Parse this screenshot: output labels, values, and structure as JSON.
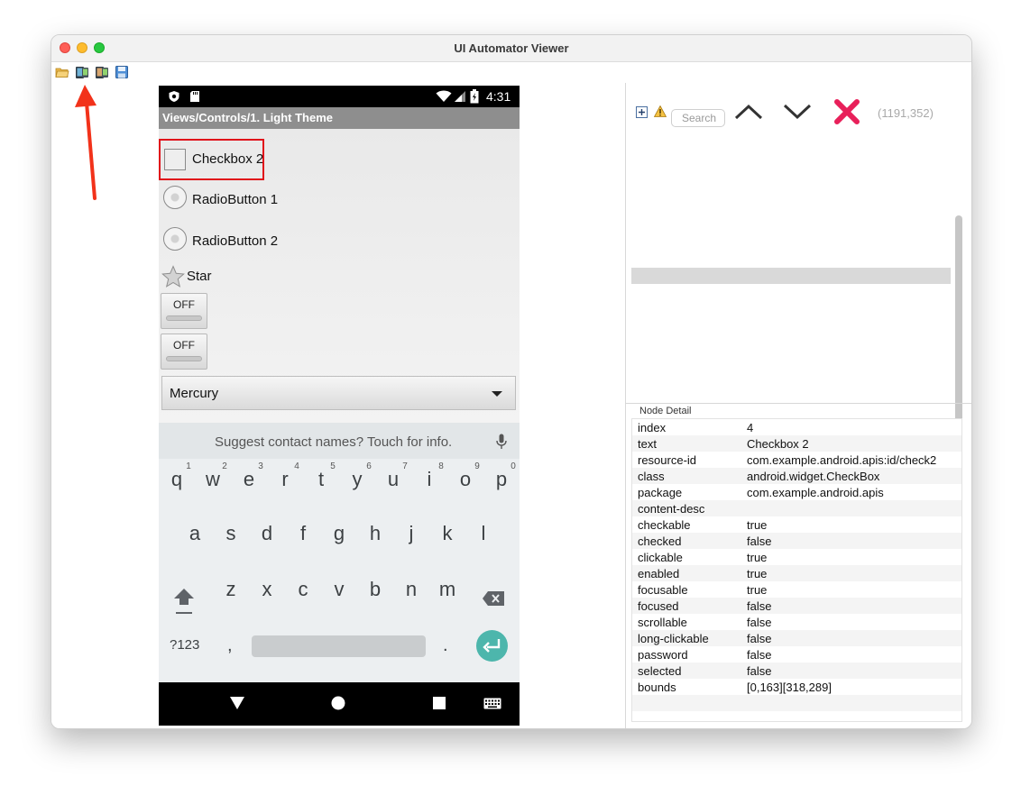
{
  "window": {
    "title": "UI Automator Viewer"
  },
  "phone": {
    "status_time": "4:31",
    "action_bar_title": "Views/Controls/1. Light Theme",
    "controls": {
      "checkbox_label": "Checkbox 2",
      "radio1_label": "RadioButton 1",
      "radio2_label": "RadioButton 2",
      "star_label": "Star",
      "toggle1_label": "OFF",
      "toggle2_label": "OFF",
      "spinner_value": "Mercury"
    },
    "keyboard": {
      "suggestion": "Suggest contact names? Touch for info.",
      "row1": [
        "q",
        "w",
        "e",
        "r",
        "t",
        "y",
        "u",
        "i",
        "o",
        "p"
      ],
      "row1_numbers": [
        "1",
        "2",
        "3",
        "4",
        "5",
        "6",
        "7",
        "8",
        "9",
        "0"
      ],
      "row2": [
        "a",
        "s",
        "d",
        "f",
        "g",
        "h",
        "j",
        "k",
        "l"
      ],
      "row3": [
        "z",
        "x",
        "c",
        "v",
        "b",
        "n",
        "m"
      ],
      "symbols_key": "?123",
      "comma_key": ",",
      "period_key": "."
    }
  },
  "right_panel": {
    "search_placeholder": "Search",
    "coordinates": "(1191,352)",
    "node_detail_title": "Node Detail",
    "node_detail": [
      {
        "key": "index",
        "value": "4"
      },
      {
        "key": "text",
        "value": "Checkbox 2"
      },
      {
        "key": "resource-id",
        "value": "com.example.android.apis:id/check2"
      },
      {
        "key": "class",
        "value": "android.widget.CheckBox"
      },
      {
        "key": "package",
        "value": "com.example.android.apis"
      },
      {
        "key": "content-desc",
        "value": ""
      },
      {
        "key": "checkable",
        "value": "true"
      },
      {
        "key": "checked",
        "value": "false"
      },
      {
        "key": "clickable",
        "value": "true"
      },
      {
        "key": "enabled",
        "value": "true"
      },
      {
        "key": "focusable",
        "value": "true"
      },
      {
        "key": "focused",
        "value": "false"
      },
      {
        "key": "scrollable",
        "value": "false"
      },
      {
        "key": "long-clickable",
        "value": "false"
      },
      {
        "key": "password",
        "value": "false"
      },
      {
        "key": "selected",
        "value": "false"
      },
      {
        "key": "bounds",
        "value": "[0,163][318,289]"
      }
    ]
  },
  "colors": {
    "highlight": "#e0101a",
    "arrow": "#f2321a",
    "close_x": "#e8205a",
    "enter_key": "#4db6ac"
  },
  "icons": [
    "open-folder-icon",
    "device-screenshot-icon",
    "device-screenshot-compressed-icon",
    "save-icon",
    "expand-all-icon",
    "warning-icon",
    "chevron-up-icon",
    "chevron-down-icon",
    "close-icon",
    "microphone-icon",
    "shift-icon",
    "backspace-icon",
    "enter-icon",
    "back-icon",
    "home-icon",
    "recents-icon",
    "keyboard-icon"
  ]
}
